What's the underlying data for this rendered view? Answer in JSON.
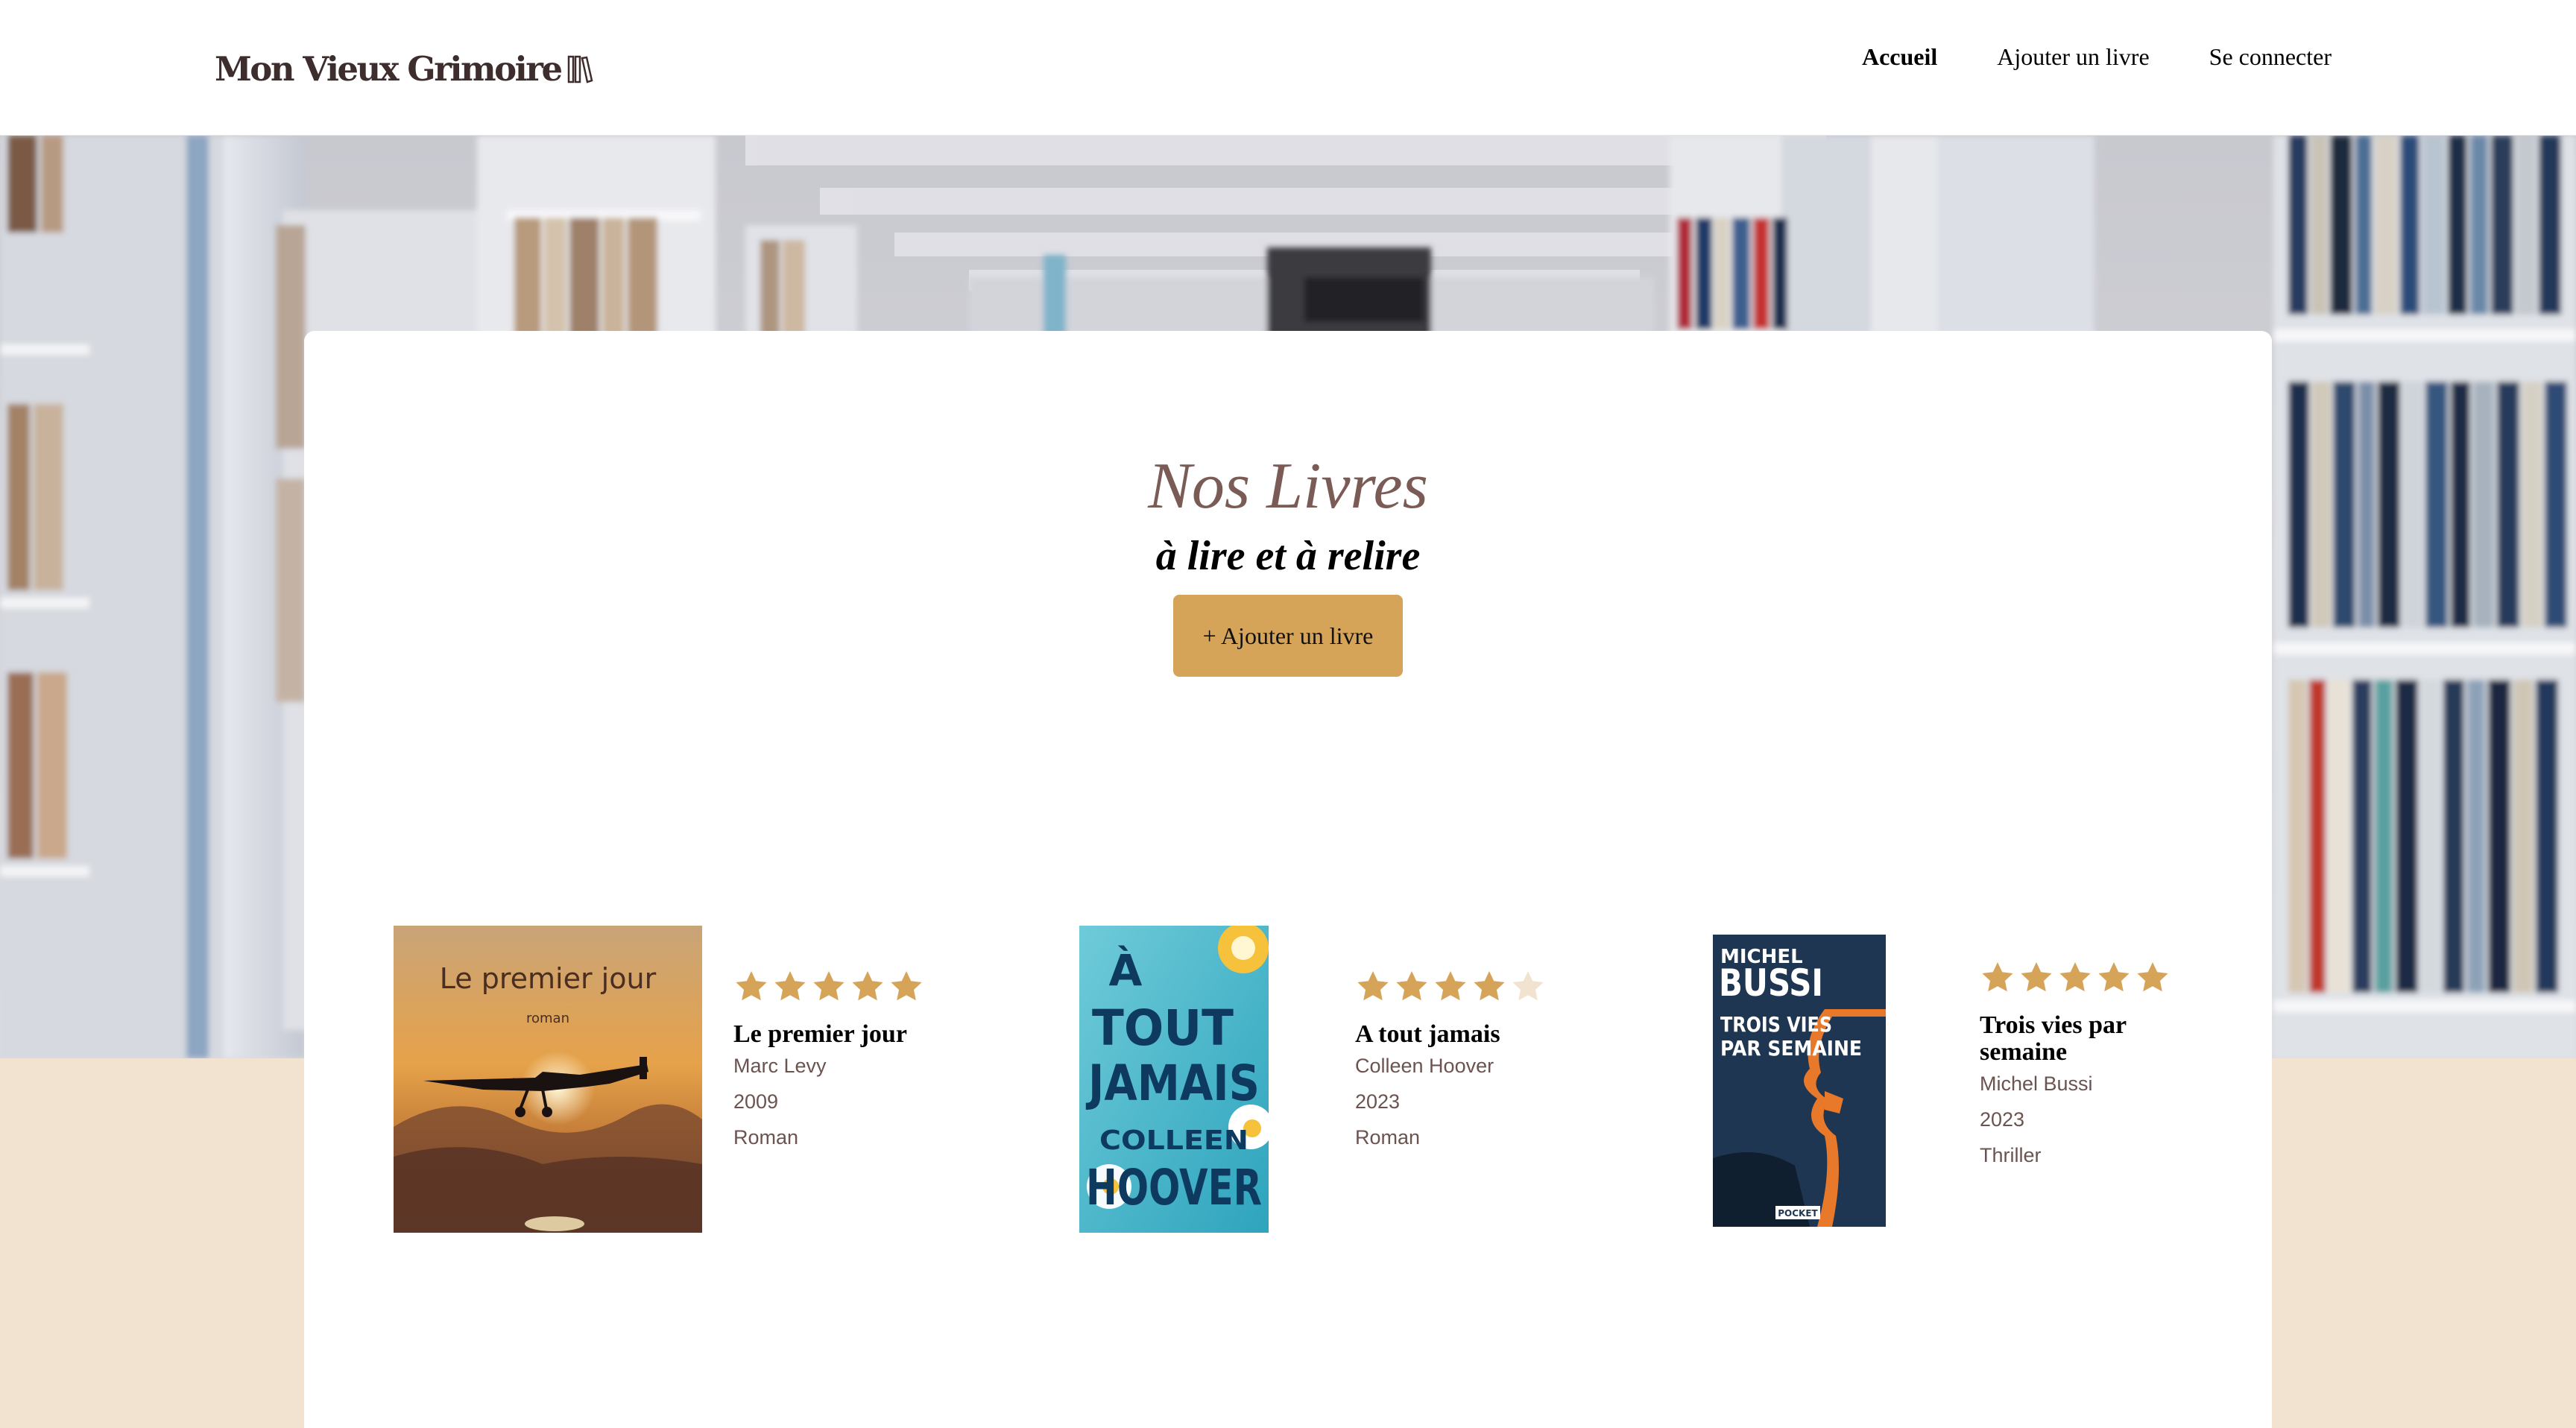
{
  "header": {
    "logo_text": "Mon Vieux Grimoire",
    "nav": [
      {
        "label": "Accueil",
        "active": true
      },
      {
        "label": "Ajouter un livre",
        "active": false
      },
      {
        "label": "Se connecter",
        "active": false
      }
    ]
  },
  "main": {
    "title": "Nos Livres",
    "subtitle": "à lire et à relire",
    "add_button_label": "+ Ajouter un livre"
  },
  "books": [
    {
      "title": "Le premier jour",
      "author": "Marc Levy",
      "year": "2009",
      "genre": "Roman",
      "rating": 5,
      "cover": {
        "title": "Le premier jour",
        "subtitle": "roman"
      }
    },
    {
      "title": "A tout jamais",
      "author": "Colleen Hoover",
      "year": "2023",
      "genre": "Roman",
      "rating": 4,
      "cover": {
        "line1": "À",
        "line2": "TOUT",
        "line3": "JAMAIS",
        "line4": "COLLEEN",
        "line5": "HOOVER"
      }
    },
    {
      "title": "Trois vies par semaine",
      "author": "Michel Bussi",
      "year": "2023",
      "genre": "Thriller",
      "rating": 5,
      "cover": {
        "author_first": "MICHEL",
        "author_last": "BUSSI",
        "title_line1": "TROIS VIES",
        "title_line2": "PAR SEMAINE",
        "publisher": "POCKET"
      }
    }
  ],
  "colors": {
    "accent": "#d6a458",
    "star_filled": "#d6a458",
    "star_empty": "#f2e3d1",
    "title_color": "#7a5b55",
    "beige": "#f2e3d1"
  }
}
